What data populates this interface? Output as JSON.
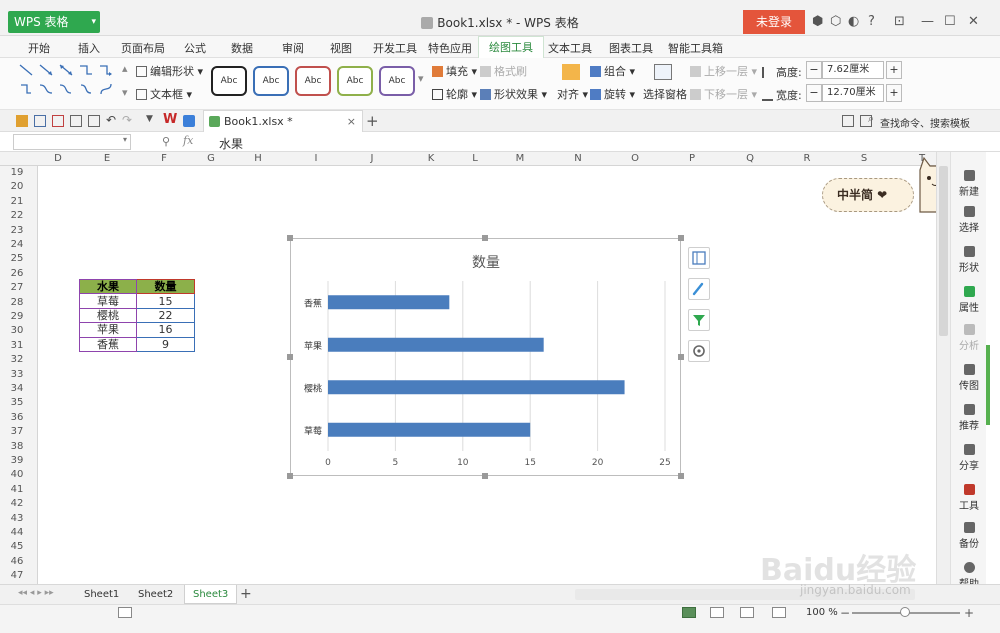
{
  "titlebar": {
    "app_name": "WPS 表格",
    "doc_title": "Book1.xlsx * - WPS 表格",
    "login_label": "未登录",
    "help_label": "?"
  },
  "menu": {
    "tabs": [
      "开始",
      "插入",
      "页面布局",
      "公式",
      "数据",
      "审阅",
      "视图",
      "开发工具",
      "特色应用",
      "绘图工具",
      "文本工具",
      "图表工具",
      "智能工具箱"
    ],
    "active": "绘图工具"
  },
  "ribbon": {
    "edit_shape": "编辑形状",
    "text_box": "文本框",
    "style_samples": [
      "Abc",
      "Abc",
      "Abc",
      "Abc",
      "Abc"
    ],
    "style_colors": [
      "#222222",
      "#3a6fb6",
      "#c0504d",
      "#8fb04a",
      "#7a5ea8"
    ],
    "fill": "填充",
    "format_brush": "格式刷",
    "outline": "轮廓",
    "shape_effect": "形状效果",
    "align": "对齐",
    "group": "组合",
    "rotate": "旋转",
    "select_pane": "选择窗格",
    "move_up": "上移一层",
    "move_down": "下移一层",
    "height_label": "高度:",
    "height_value": "7.62厘米",
    "width_label": "宽度:",
    "width_value": "12.70厘米",
    "minus": "−",
    "plus": "+"
  },
  "quickbar": {
    "doc_tab": "Book1.xlsx *",
    "close": "×",
    "add": "+",
    "search_hint": "查找命令、搜索模板"
  },
  "formula": {
    "fx": "fx",
    "content": "水果"
  },
  "grid": {
    "columns": [
      "D",
      "E",
      "F",
      "G",
      "H",
      "I",
      "J",
      "K",
      "L",
      "M",
      "N",
      "O",
      "P",
      "Q",
      "R",
      "S",
      "T"
    ],
    "rows": [
      "19",
      "20",
      "21",
      "22",
      "23",
      "24",
      "25",
      "26",
      "27",
      "28",
      "29",
      "30",
      "31",
      "32",
      "33",
      "34",
      "35",
      "36",
      "37",
      "38",
      "39",
      "40",
      "41",
      "42",
      "43",
      "44",
      "45",
      "46",
      "47"
    ]
  },
  "table": {
    "header": [
      "水果",
      "数量"
    ],
    "rows": [
      [
        "草莓",
        "15"
      ],
      [
        "樱桃",
        "22"
      ],
      [
        "苹果",
        "16"
      ],
      [
        "香蕉",
        "9"
      ]
    ]
  },
  "chart_data": {
    "type": "bar",
    "orientation": "horizontal",
    "title": "数量",
    "categories": [
      "香蕉",
      "苹果",
      "樱桃",
      "草莓"
    ],
    "values": [
      9,
      16,
      22,
      15
    ],
    "xlim": [
      0,
      25
    ],
    "xticks": [
      "0",
      "5",
      "10",
      "15",
      "20",
      "25"
    ],
    "grid": true,
    "bar_color": "#4a7dbd"
  },
  "sticker": {
    "text": "中半简 ❤"
  },
  "sidebar": {
    "items": [
      "新建",
      "选择",
      "形状",
      "属性",
      "分析",
      "传图",
      "推荐",
      "分享",
      "工具",
      "备份",
      "帮助"
    ]
  },
  "sheets": {
    "tabs": [
      "Sheet1",
      "Sheet2",
      "Sheet3"
    ],
    "active": "Sheet3",
    "add": "+"
  },
  "status": {
    "zoom": "100 %",
    "minus": "−",
    "plus": "+"
  },
  "watermark": {
    "brand": "Baidu经验",
    "url": "jingyan.baidu.com"
  }
}
